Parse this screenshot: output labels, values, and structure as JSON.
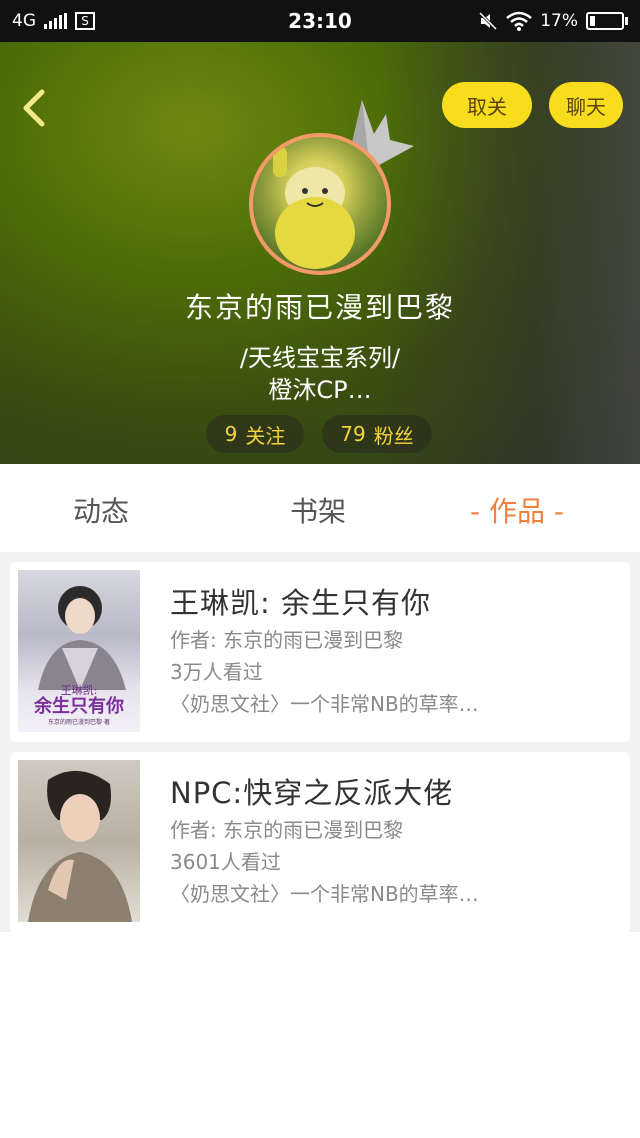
{
  "status_bar": {
    "network": "4G",
    "sim_label": "S",
    "time": "23:10",
    "battery": "17%",
    "battery_level": 0.17
  },
  "header": {
    "actions": {
      "unfollow": "取关",
      "chat": "聊天"
    },
    "username": "东京的雨已漫到巴黎",
    "bio_line1": "/天线宝宝系列/",
    "bio_line2": "橙沐CP…",
    "stats": {
      "following_count": "9",
      "following_label": "关注",
      "fans_count": "79",
      "fans_label": "粉丝"
    }
  },
  "tabs": {
    "dynamic": "动态",
    "shelf": "书架",
    "works": "- 作品 -",
    "active": "works"
  },
  "books": [
    {
      "title": "王琳凯: 余生只有你",
      "author": "作者: 东京的雨已漫到巴黎",
      "views": "3万人看过",
      "description": "〈奶思文社〉一个非常NB的草率…",
      "cover_text": "王琳凯:",
      "cover_title": "余生只有你",
      "cover_subtitle": "东京的雨已漫到巴黎·著"
    },
    {
      "title": "NPC:快穿之反派大佬",
      "author": "作者: 东京的雨已漫到巴黎",
      "views": "3601人看过",
      "description": "〈奶思文社〉一个非常NB的草率…"
    }
  ],
  "colors": {
    "accent_yellow": "#f7dd1e",
    "active_tab": "#f08040",
    "stat_text": "#f5d33a"
  }
}
